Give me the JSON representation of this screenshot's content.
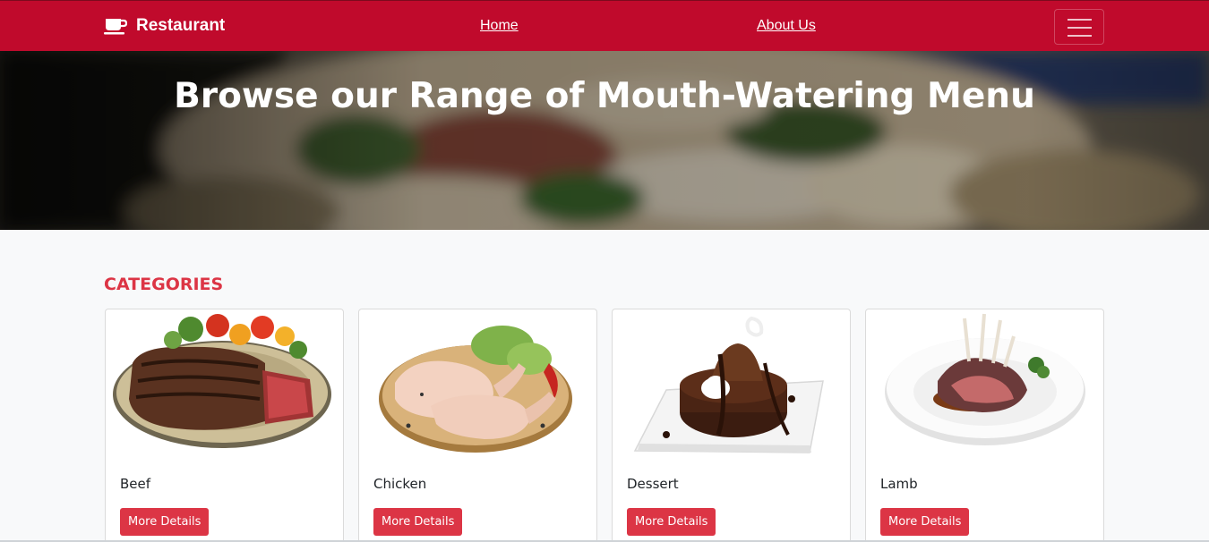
{
  "navbar": {
    "brand": "Restaurant",
    "brand_icon": "coffee-cup-icon",
    "links": [
      "Home",
      "About Us"
    ],
    "toggler_icon": "hamburger-menu-icon",
    "color": "#c00a2c"
  },
  "hero": {
    "title": "Browse our Range of Mouth-Watering Menu"
  },
  "categories": {
    "heading": "CATEGORIES",
    "items": [
      {
        "name": "Beef",
        "button": "More Details"
      },
      {
        "name": "Chicken",
        "button": "More Details"
      },
      {
        "name": "Dessert",
        "button": "More Details"
      },
      {
        "name": "Lamb",
        "button": "More Details"
      }
    ]
  },
  "colors": {
    "accent": "#dc3545",
    "background": "#f8f9fa"
  }
}
